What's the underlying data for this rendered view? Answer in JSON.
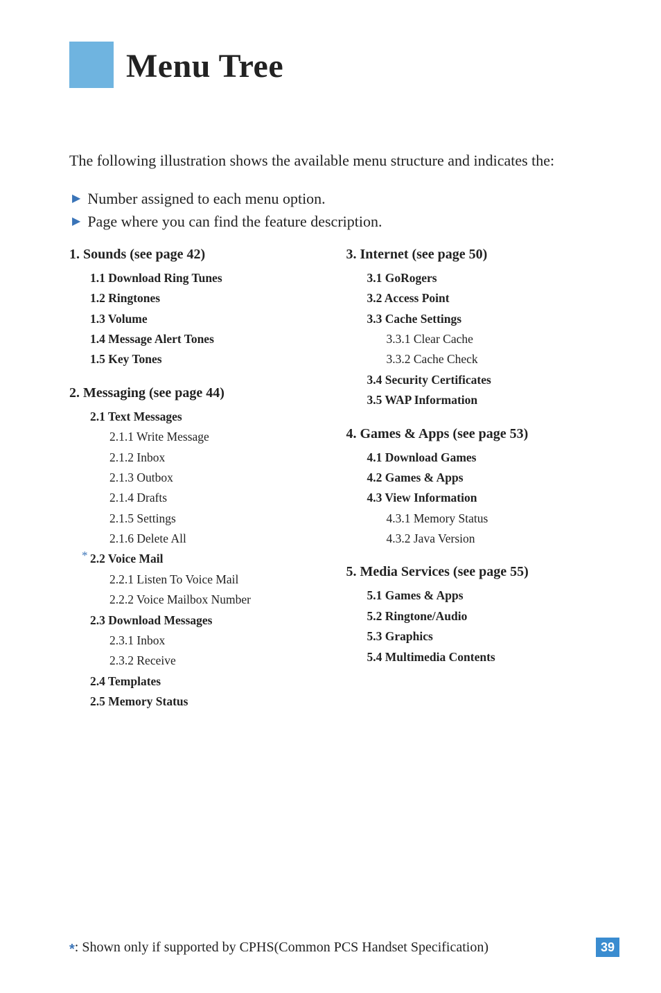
{
  "title": "Menu Tree",
  "intro": "The following illustration shows the available menu structure and indicates the:",
  "bullets": [
    "Number assigned to each menu option.",
    "Page where you can find the feature description."
  ],
  "left": {
    "s1": {
      "h": "1.  Sounds (see page 42)",
      "i": [
        "1.1 Download Ring Tunes",
        "1.2 Ringtones",
        "1.3 Volume",
        "1.4 Message Alert Tones",
        "1.5 Key Tones"
      ]
    },
    "s2": {
      "h": "2.  Messaging (see page 44)",
      "g21": {
        "h": "2.1 Text Messages",
        "i": [
          "2.1.1 Write Message",
          "2.1.2 Inbox",
          "2.1.3 Outbox",
          "2.1.4 Drafts",
          "2.1.5 Settings",
          "2.1.6 Delete All"
        ]
      },
      "g22": {
        "h": "2.2 Voice Mail",
        "i": [
          "2.2.1 Listen To Voice Mail",
          "2.2.2 Voice Mailbox Number"
        ]
      },
      "g23": {
        "h": "2.3 Download Messages",
        "i": [
          "2.3.1 Inbox",
          "2.3.2 Receive"
        ]
      },
      "g24": "2.4 Templates",
      "g25": "2.5 Memory Status"
    }
  },
  "right": {
    "s3": {
      "h": "3.  Internet (see page 50)",
      "i31": "3.1 GoRogers",
      "i32": "3.2 Access Point",
      "g33": {
        "h": "3.3 Cache Settings",
        "i": [
          "3.3.1 Clear Cache",
          "3.3.2 Cache Check"
        ]
      },
      "i34": "3.4 Security Certificates",
      "i35": "3.5 WAP Information"
    },
    "s4": {
      "h": "4.  Games & Apps (see page 53)",
      "i41": "4.1 Download Games",
      "i42": "4.2 Games & Apps",
      "g43": {
        "h": "4.3 View Information",
        "i": [
          "4.3.1 Memory Status",
          "4.3.2 Java Version"
        ]
      }
    },
    "s5": {
      "h": "5.  Media Services (see page 55)",
      "i": [
        "5.1 Games & Apps",
        "5.2 Ringtone/Audio",
        "5.3 Graphics",
        "5.4 Multimedia Contents"
      ]
    }
  },
  "footnote": ": Shown only if supported by CPHS(Common PCS Handset Specification)",
  "footnote_star": "*",
  "page_number": "39"
}
